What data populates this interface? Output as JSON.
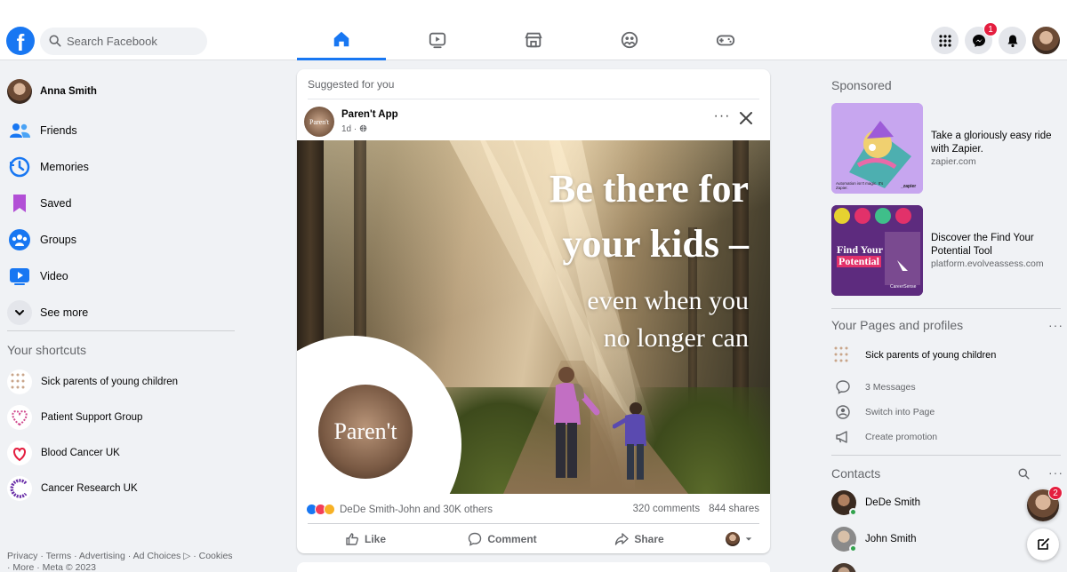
{
  "topbar": {
    "logo_letter": "f",
    "search_placeholder": "Search Facebook",
    "tabs": [
      "home",
      "watch",
      "marketplace",
      "groups",
      "gaming"
    ],
    "active_tab": "home",
    "messenger_badge": "1"
  },
  "leftnav": {
    "profile_name": "Anna Smith",
    "items": [
      {
        "label": "Friends",
        "icon": "friends-icon"
      },
      {
        "label": "Memories",
        "icon": "memories-icon"
      },
      {
        "label": "Saved",
        "icon": "saved-icon"
      },
      {
        "label": "Groups",
        "icon": "groups-icon"
      },
      {
        "label": "Video",
        "icon": "video-icon"
      },
      {
        "label": "See more",
        "icon": "chevron-down-icon"
      }
    ],
    "shortcuts_title": "Your shortcuts",
    "shortcuts": [
      "Sick parents of young children",
      "Patient Support Group",
      "Blood Cancer UK",
      "Cancer Research UK"
    ],
    "footer_line1": "Privacy · Terms · Advertising · Ad Choices ▷ · Cookies",
    "footer_line2": "· More · Meta © 2023"
  },
  "post": {
    "suggested": "Suggested for you",
    "page_name": "Paren't App",
    "avatar_text": "Paren't",
    "meta": "1d · ",
    "headline_1": "Be there for",
    "headline_2": "your kids –",
    "subline_1": "even when you",
    "subline_2": "no longer can",
    "logo_text": "Paren't",
    "reactions_text": "DeDe Smith-John and 30K others",
    "comments": "320 comments",
    "shares": "844 shares",
    "like": "Like",
    "comment": "Comment",
    "share": "Share"
  },
  "right": {
    "sponsored_title": "Sponsored",
    "ads": [
      {
        "title": "Take a gloriously easy ride with Zapier.",
        "url": "zapier.com"
      },
      {
        "title": "Discover the Find Your Potential Tool",
        "url": "platform.evolveassess.com"
      }
    ],
    "ad1_caption": "Automation isn't magic. It's Zapier.",
    "ad1_brand": "_zapier",
    "ad2_headline_1": "Find Your",
    "ad2_headline_2": "Potential",
    "ad2_brand": "CareerSense",
    "pages_title": "Your Pages and profiles",
    "page_item": "Sick parents of young children",
    "page_actions": [
      "3 Messages",
      "Switch into Page",
      "Create promotion"
    ],
    "contacts_title": "Contacts",
    "contacts": [
      "DeDe Smith",
      "John Smith"
    ],
    "chat_badge": "2"
  },
  "colors": {
    "brand": "#1877f2",
    "badge": "#e41e3f",
    "online": "#31a24c"
  }
}
